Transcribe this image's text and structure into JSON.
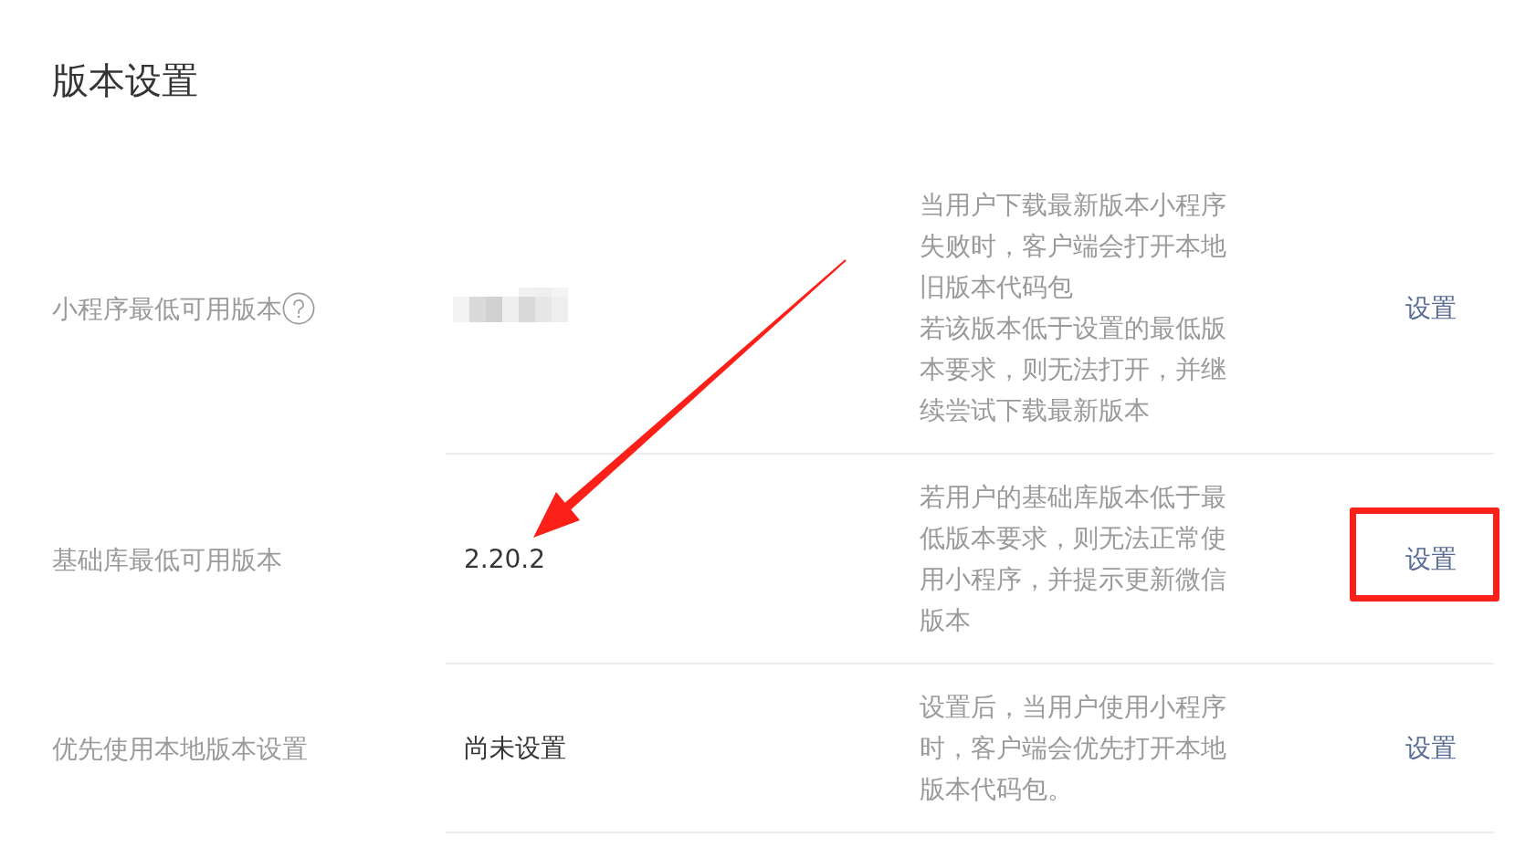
{
  "page": {
    "title": "版本设置"
  },
  "rows": [
    {
      "label": "小程序最低可用版本",
      "help": true,
      "redacted": true,
      "description": [
        "当用户下载最新版本小程序失败时，客户端会打开本地旧版本代码包",
        "若该版本低于设置的最低版本要求，则无法打开，并继续尝试下载最新版本"
      ],
      "action": "设置",
      "annotation_arrow": false,
      "annotation_box": false
    },
    {
      "label": "基础库最低可用版本",
      "help": false,
      "redacted": false,
      "value": "2.20.2",
      "description": [
        "若用户的基础库版本低于最低版本要求，则无法正常使用小程序，并提示更新微信版本"
      ],
      "action": "设置",
      "annotation_arrow": true,
      "annotation_box": true
    },
    {
      "label": "优先使用本地版本设置",
      "help": false,
      "redacted": false,
      "value": "尚未设置",
      "description": [
        "设置后，当用户使用小程序时，客户端会优先打开本地版本代码包。"
      ],
      "action": "设置",
      "annotation_arrow": false,
      "annotation_box": false
    }
  ]
}
